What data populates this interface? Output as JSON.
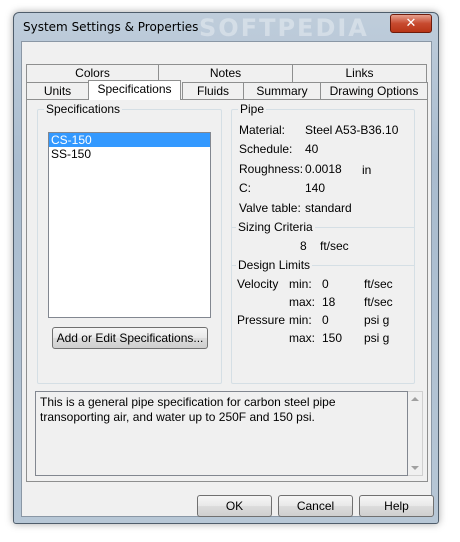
{
  "window": {
    "title": "System Settings & Properties",
    "watermark": "SOFTPEDIA",
    "close_glyph": "✕"
  },
  "tabs": {
    "row_back": [
      {
        "label": "Colors"
      },
      {
        "label": "Notes"
      },
      {
        "label": "Links"
      }
    ],
    "row_front": [
      {
        "label": "Units"
      },
      {
        "label": "Specifications"
      },
      {
        "label": "Fluids"
      },
      {
        "label": "Summary"
      },
      {
        "label": "Drawing Options"
      }
    ],
    "active": "Specifications"
  },
  "specifications": {
    "group_label": "Specifications",
    "items": [
      {
        "label": "CS-150",
        "selected": true
      },
      {
        "label": "SS-150",
        "selected": false
      }
    ],
    "edit_button": "Add or Edit Specifications..."
  },
  "pipe": {
    "group_label": "Pipe",
    "material_label": "Material:",
    "material_value": "Steel A53-B36.10",
    "schedule_label": "Schedule:",
    "schedule_value": "40",
    "roughness_label": "Roughness:",
    "roughness_value": "0.0018",
    "roughness_unit": "in",
    "c_label": "C:",
    "c_value": "140",
    "valve_label": "Valve table:",
    "valve_value": "standard"
  },
  "sizing": {
    "group_label": "Sizing Criteria",
    "value": "8",
    "unit": "ft/sec"
  },
  "design_limits": {
    "group_label": "Design Limits",
    "velocity_label": "Velocity",
    "velocity_min_label": "min:",
    "velocity_min_value": "0",
    "velocity_min_unit": "ft/sec",
    "velocity_max_label": "max:",
    "velocity_max_value": "18",
    "velocity_max_unit": "ft/sec",
    "pressure_label": "Pressure",
    "pressure_min_label": "min:",
    "pressure_min_value": "0",
    "pressure_min_unit": "psi g",
    "pressure_max_label": "max:",
    "pressure_max_value": "150",
    "pressure_max_unit": "psi g"
  },
  "description": "This is a general pipe specification for carbon steel pipe transoporting air, and water up to 250F and 150 psi.",
  "buttons": {
    "ok": "OK",
    "cancel": "Cancel",
    "help": "Help"
  }
}
